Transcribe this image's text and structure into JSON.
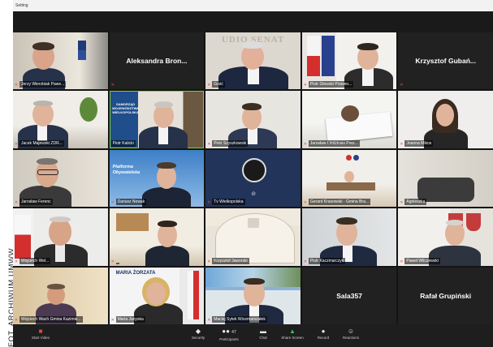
{
  "photo_credit": "FOT. ARCHIWUM UMWW",
  "window_title": "Setting",
  "tiles": {
    "aleksandra": "Aleksandra Bron...",
    "krzysztof_g": "Krzysztof Gubań...",
    "sala": "Sala357",
    "rafal": "Rafał Grupiński",
    "t1": "Jerzy Wierzbiak Pawe...",
    "t3": "Gość",
    "t4": "Piotr Głowski Przewo...",
    "t6": "Jacek Majewski ZDR...",
    "t7": "Piotr Kalicki",
    "t8": "Piotr Szyszkowski",
    "t9": "Jarosław Lindzinski Prez...",
    "t10": "Joanna Mikos",
    "t11": "Jarosław Ferenc",
    "t12": "Dariusz Nowak",
    "t13": "Tv Wielkopolska",
    "t14": "Gerard Krasowski - Gmina Bra...",
    "t15": "Agnieszka",
    "t16": "Wojciech Wel...",
    "t17": "",
    "t18": "Krzysztof Jaworski",
    "t19": "Piotr Kaczmarczyk",
    "t20": "Paweł Wilczewski",
    "t21": "Wojciech Wach Gmina Kazimie...",
    "t22": "Maria Janyska",
    "t23": "Maciej Sytek Wicemarszałek"
  },
  "poster_text": "MARIA ŻORZATA",
  "banner_samorzad": "SAMORZĄD WOJEWÓDZTWA WIELKOPOLSKA",
  "banner_platform": "Platforma Obywatelska",
  "senat_text": "UDIO SENAT",
  "toolbar": {
    "video": "Start Video",
    "security": "Security",
    "participants": "Participants",
    "participants_count": "47",
    "chat": "Chat",
    "share": "Share Screen",
    "record": "Record",
    "reactions": "Reactions"
  },
  "colors": {
    "active_border": "#7fd12c",
    "share_green": "#33c15a",
    "mute_red": "#e74c3c"
  }
}
